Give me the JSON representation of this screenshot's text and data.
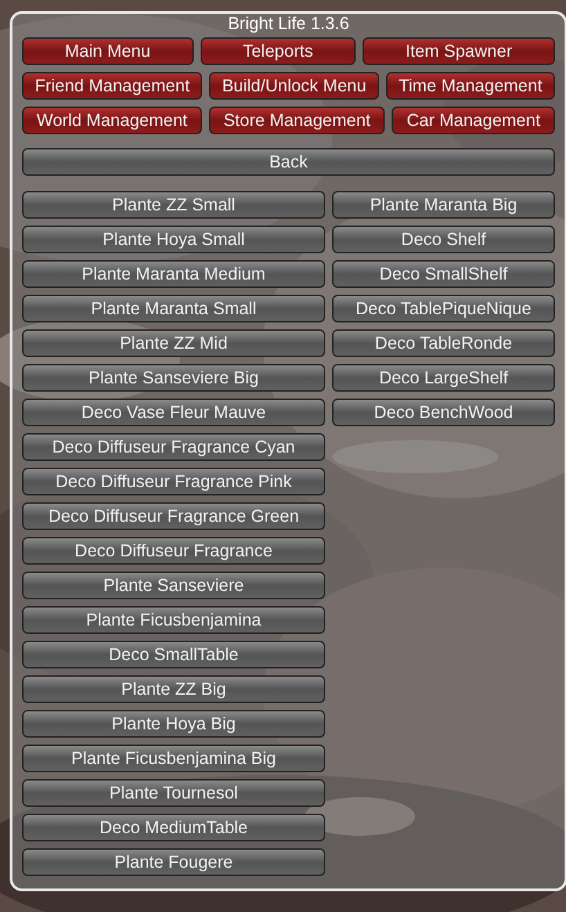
{
  "window": {
    "title": "Bright Life 1.3.6"
  },
  "nav_rows": [
    {
      "buttons": [
        "Main Menu",
        "Teleports",
        "Item Spawner"
      ]
    },
    {
      "buttons": [
        "Friend Management",
        "Build/Unlock Menu",
        "Time Management"
      ]
    },
    {
      "buttons": [
        "World Management",
        "Store Management",
        "Car Management"
      ]
    }
  ],
  "back_button": "Back",
  "items_left": [
    "Plante ZZ Small",
    "Plante Hoya Small",
    "Plante Maranta Medium",
    "Plante Maranta Small",
    "Plante ZZ Mid",
    "Plante Sanseviere Big",
    "Deco Vase Fleur Mauve",
    "Deco Diffuseur Fragrance Cyan",
    "Deco Diffuseur Fragrance Pink",
    "Deco Diffuseur Fragrance Green",
    "Deco Diffuseur Fragrance",
    "Plante Sanseviere",
    "Plante Ficusbenjamina",
    "Deco SmallTable",
    "Plante ZZ Big",
    "Plante Hoya Big",
    "Plante Ficusbenjamina Big",
    "Plante Tournesol",
    "Deco MediumTable",
    "Plante Fougere"
  ],
  "items_right": [
    "Plante Maranta Big",
    "Deco Shelf",
    "Deco SmallShelf",
    "Deco TablePiqueNique",
    "Deco TableRonde",
    "Deco LargeShelf",
    "Deco BenchWood"
  ]
}
